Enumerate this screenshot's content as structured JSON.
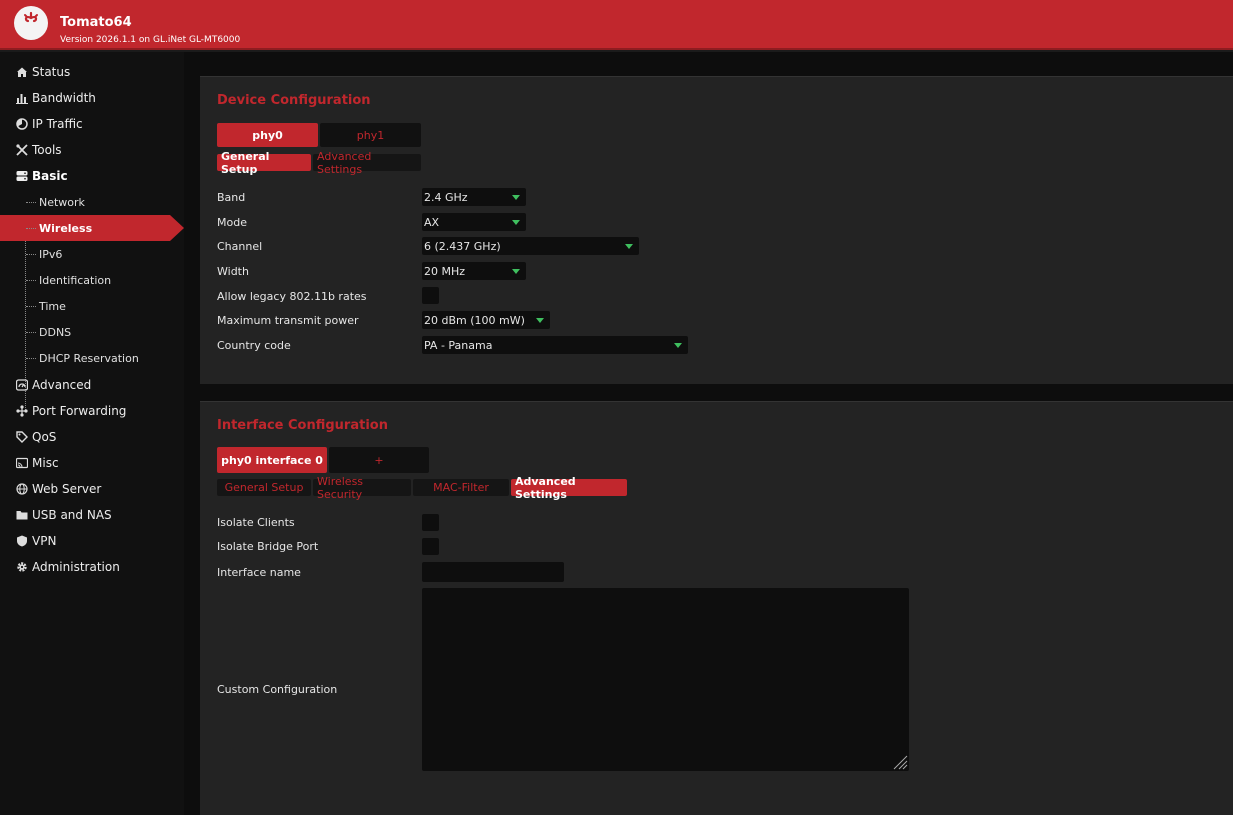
{
  "app": {
    "title": "Tomato64",
    "version": "Version 2026.1.1 on GL.iNet GL-MT6000"
  },
  "sidebar": {
    "items": [
      {
        "label": "Status",
        "icon": "home-icon"
      },
      {
        "label": "Bandwidth",
        "icon": "bar-chart-icon"
      },
      {
        "label": "IP Traffic",
        "icon": "pie-chart-icon"
      },
      {
        "label": "Tools",
        "icon": "tools-icon"
      },
      {
        "label": "Basic",
        "icon": "server-icon"
      },
      {
        "label": "Advanced",
        "icon": "gauge-icon"
      },
      {
        "label": "Port Forwarding",
        "icon": "network-icon"
      },
      {
        "label": "QoS",
        "icon": "tag-icon"
      },
      {
        "label": "Misc",
        "icon": "cast-icon"
      },
      {
        "label": "Web Server",
        "icon": "globe-icon"
      },
      {
        "label": "USB and NAS",
        "icon": "folder-icon"
      },
      {
        "label": "VPN",
        "icon": "shield-icon"
      },
      {
        "label": "Administration",
        "icon": "gear-icon"
      }
    ],
    "basic_subitems": [
      "Network",
      "Wireless",
      "IPv6",
      "Identification",
      "Time",
      "DDNS",
      "DHCP Reservation"
    ],
    "active_subitem": "Wireless"
  },
  "device_config": {
    "title": "Device Configuration",
    "phy_tabs": [
      "phy0",
      "phy1"
    ],
    "active_phy": "phy0",
    "sub_tabs": [
      "General Setup",
      "Advanced Settings"
    ],
    "active_sub_tab": "General Setup",
    "fields": {
      "band": {
        "label": "Band",
        "value": "2.4 GHz"
      },
      "mode": {
        "label": "Mode",
        "value": "AX"
      },
      "channel": {
        "label": "Channel",
        "value": "6 (2.437 GHz)"
      },
      "width": {
        "label": "Width",
        "value": "20 MHz"
      },
      "legacy": {
        "label": "Allow legacy 802.11b rates",
        "checked": false
      },
      "tx_power": {
        "label": "Maximum transmit power",
        "value": "20 dBm (100 mW)"
      },
      "country": {
        "label": "Country code",
        "value": "PA - Panama"
      }
    }
  },
  "interface_config": {
    "title": "Interface Configuration",
    "iface_tabs": [
      "phy0 interface 0",
      "+"
    ],
    "active_iface": "phy0 interface 0",
    "sub_tabs": [
      "General Setup",
      "Wireless Security",
      "MAC-Filter",
      "Advanced Settings"
    ],
    "active_sub_tab": "Advanced Settings",
    "fields": {
      "isolate_clients": {
        "label": "Isolate Clients",
        "checked": false
      },
      "isolate_bridge": {
        "label": "Isolate Bridge Port",
        "checked": false
      },
      "iface_name": {
        "label": "Interface name",
        "value": ""
      },
      "custom_config": {
        "label": "Custom Configuration",
        "value": ""
      }
    }
  },
  "colors": {
    "accent": "#c1272d",
    "caret": "#3fbf5f",
    "background": "#1b1b1b"
  }
}
